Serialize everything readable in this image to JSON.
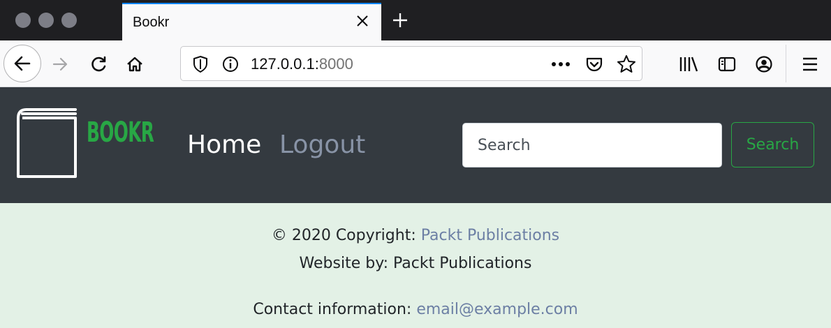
{
  "browser": {
    "tab_title": "Bookr",
    "url_host": "127.0.0.1:",
    "url_port": "8000",
    "icons": [
      "back-icon",
      "forward-icon",
      "reload-icon",
      "home-icon",
      "tracking-shield-icon",
      "site-info-icon",
      "page-actions-icon",
      "pocket-icon",
      "bookmark-star-icon",
      "library-icon",
      "sidebar-icon",
      "account-icon",
      "menu-icon"
    ]
  },
  "site": {
    "brand": "BOOKR",
    "nav": {
      "home": "Home",
      "logout": "Logout"
    },
    "search": {
      "placeholder": "Search",
      "button": "Search"
    },
    "colors": {
      "navbar": "#343a40",
      "accent": "#28a745",
      "footer_bg": "#e3f1e6",
      "link": "#6c7fa4"
    }
  },
  "footer": {
    "copyright_prefix": "© 2020 Copyright: ",
    "copyright_link": "Packt Publications",
    "website_by": "Website by: Packt Publications",
    "contact_prefix": "Contact information: ",
    "contact_email": "email@example.com"
  }
}
